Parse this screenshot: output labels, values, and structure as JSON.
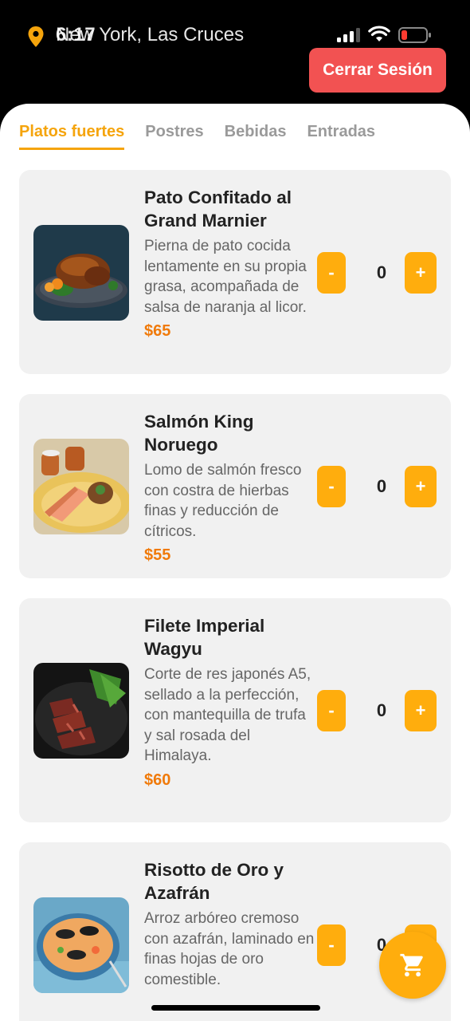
{
  "status": {
    "time": "6:17",
    "location": "New York, Las Cruces"
  },
  "header": {
    "logout_label": "Cerrar Sesión"
  },
  "tabs": [
    {
      "label": "Platos fuertes",
      "active": true
    },
    {
      "label": "Postres",
      "active": false
    },
    {
      "label": "Bebidas",
      "active": false
    },
    {
      "label": "Entradas",
      "active": false
    }
  ],
  "dishes": [
    {
      "name": "Pato Confitado al Grand Marnier",
      "description": "Pierna de pato cocida lentamente en su propia grasa, acompañada de salsa de naranja al licor.",
      "price": "$65",
      "minus": "-",
      "plus": "+",
      "quantity": "0",
      "image": "roast-duck-photo"
    },
    {
      "name": "Salmón King Noruego",
      "description": "Lomo de salmón fresco con costra de hierbas finas y reducción de cítricos.",
      "price": "$55",
      "minus": "-",
      "plus": "+",
      "quantity": "0",
      "image": "salmon-photo"
    },
    {
      "name": "Filete Imperial Wagyu",
      "description": "Corte de res japonés A5, sellado a la perfección, con mantequilla de trufa y sal rosada del Himalaya.",
      "price": "$60",
      "minus": "-",
      "plus": "+",
      "quantity": "0",
      "image": "wagyu-steak-photo"
    },
    {
      "name": "Risotto de Oro y Azafrán",
      "description": "Arroz arbóreo cremoso con azafrán, laminado en finas hojas de oro comestible.",
      "price": "",
      "minus": "-",
      "plus": "+",
      "quantity": "0",
      "image": "seafood-risotto-photo"
    }
  ],
  "colors": {
    "accent": "#ffad0d",
    "tab_active": "#f5a40c",
    "logout": "#f25252",
    "price": "#f07a0a",
    "card_bg": "#f1f1f1"
  },
  "icons": {
    "location": "location-pin-icon",
    "cart": "shopping-cart-icon"
  }
}
